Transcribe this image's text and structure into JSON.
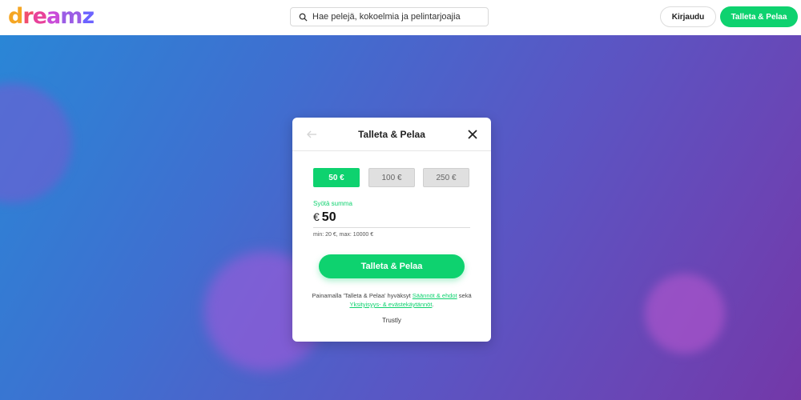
{
  "header": {
    "logo_letters": [
      "d",
      "r",
      "e",
      "a",
      "m",
      "z"
    ],
    "logo_colors": [
      "#f5a623",
      "#f04e6e",
      "#e8429a",
      "#c94bd8",
      "#9b5de5",
      "#6c63ff"
    ],
    "search_placeholder": "Hae pelejä, kokoelmia ja pelintarjoajia",
    "login_label": "Kirjaudu",
    "deposit_label": "Talleta & Pelaa"
  },
  "modal": {
    "title": "Talleta & Pelaa",
    "amount_options": [
      {
        "label": "50 €",
        "selected": true
      },
      {
        "label": "100 €",
        "selected": false
      },
      {
        "label": "250 €",
        "selected": false
      }
    ],
    "field_label": "Syötä summa",
    "currency_symbol": "€",
    "amount_value": "50",
    "limits": "min: 20 €, max: 10000 €",
    "submit_label": "Talleta & Pelaa",
    "terms_prefix": "Painamalla 'Talleta & Pelaa' hyväksyt ",
    "terms_link1": "Säännöt & ehdot",
    "terms_middle": " sekä ",
    "terms_link2": "Yksityisyys- & evästekäytännöt",
    "terms_suffix": ".",
    "provider": "Trustly"
  },
  "colors": {
    "accent": "#0ed26f",
    "background_gradient": [
      "#2a86d6",
      "#7338a8"
    ]
  },
  "icons": [
    "search-icon",
    "back-arrow-icon",
    "close-icon",
    "trustly-logo-icon"
  ]
}
